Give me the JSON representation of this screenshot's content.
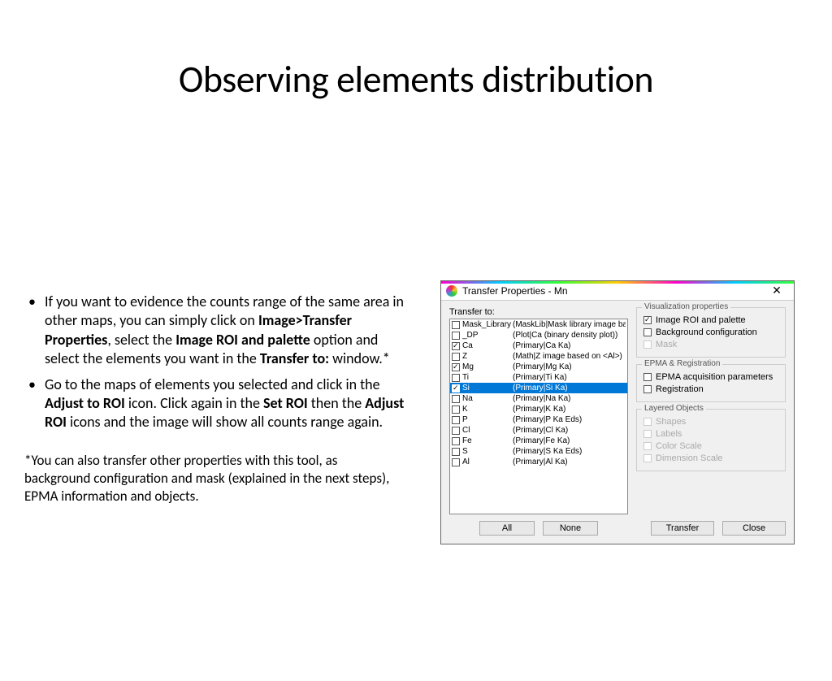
{
  "title": "Observing elements distribution",
  "bullets": {
    "b1_pre": "If you want to evidence the counts range of the same area in other maps, you can simply click on ",
    "b1_bold1": "Image>Transfer Properties",
    "b1_mid1": ", select the ",
    "b1_bold2": "Image ROI and palette",
    "b1_mid2": " option and select the elements you want in the ",
    "b1_bold3": "Transfer to:",
    "b1_end": " window.*",
    "b2_pre": "Go to the maps of elements you selected and click in the ",
    "b2_bold1": "Adjust to ROI",
    "b2_mid1": " icon. Click again in the ",
    "b2_bold2": "Set ROI",
    "b2_mid2": " then the ",
    "b2_bold3": "Adjust ROI",
    "b2_end": " icons and the image will show all counts range again."
  },
  "footnote": "*You can also transfer other properties with this tool, as background configuration and mask (explained in the next steps), EPMA information and objects.",
  "dialog": {
    "title": "Transfer Properties - Mn",
    "transfer_to": "Transfer to:",
    "items": [
      {
        "name": "Mask_Library",
        "desc": "(MaskLib|Mask library image based",
        "checked": false,
        "sel": false
      },
      {
        "name": "_DP",
        "desc": "(Plot|Ca (binary density plot))",
        "checked": false,
        "sel": false
      },
      {
        "name": "Ca",
        "desc": "(Primary|Ca Ka)",
        "checked": true,
        "sel": false
      },
      {
        "name": "Z",
        "desc": "(Math|Z image based on <Al>)",
        "checked": false,
        "sel": false
      },
      {
        "name": "Mg",
        "desc": "(Primary|Mg Ka)",
        "checked": true,
        "sel": false
      },
      {
        "name": "Ti",
        "desc": "(Primary|Ti Ka)",
        "checked": false,
        "sel": false
      },
      {
        "name": "Si",
        "desc": "(Primary|Si Ka)",
        "checked": true,
        "sel": true
      },
      {
        "name": "Na",
        "desc": "(Primary|Na Ka)",
        "checked": false,
        "sel": false
      },
      {
        "name": "K",
        "desc": "(Primary|K  Ka)",
        "checked": false,
        "sel": false
      },
      {
        "name": "P",
        "desc": "(Primary|P  Ka Eds)",
        "checked": false,
        "sel": false
      },
      {
        "name": "Cl",
        "desc": "(Primary|Cl Ka)",
        "checked": false,
        "sel": false
      },
      {
        "name": "Fe",
        "desc": "(Primary|Fe Ka)",
        "checked": false,
        "sel": false
      },
      {
        "name": "S",
        "desc": "(Primary|S  Ka Eds)",
        "checked": false,
        "sel": false
      },
      {
        "name": "Al",
        "desc": "(Primary|Al Ka)",
        "checked": false,
        "sel": false
      }
    ],
    "btn_all": "All",
    "btn_none": "None",
    "groups": {
      "vis": {
        "title": "Visualization properties",
        "roi": "Image ROI and palette",
        "bg": "Background configuration",
        "mask": "Mask"
      },
      "epma": {
        "title": "EPMA & Registration",
        "acq": "EPMA acquisition parameters",
        "reg": "Registration"
      },
      "layered": {
        "title": "Layered Objects",
        "shapes": "Shapes",
        "labels": "Labels",
        "colorscale": "Color Scale",
        "dimscale": "Dimension Scale"
      }
    },
    "btn_transfer": "Transfer",
    "btn_close": "Close"
  }
}
